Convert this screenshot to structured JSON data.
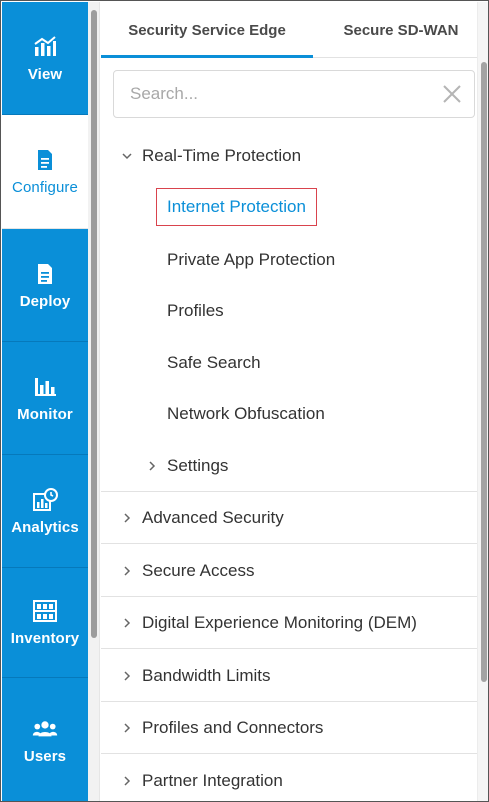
{
  "nav": {
    "items": [
      {
        "id": "view",
        "label": "View",
        "icon": "chart-bars-icon"
      },
      {
        "id": "configure",
        "label": "Configure",
        "icon": "document-icon",
        "active": true
      },
      {
        "id": "deploy",
        "label": "Deploy",
        "icon": "document-icon"
      },
      {
        "id": "monitor",
        "label": "Monitor",
        "icon": "bar-chart-icon"
      },
      {
        "id": "analytics",
        "label": "Analytics",
        "icon": "chart-clock-icon"
      },
      {
        "id": "inventory",
        "label": "Inventory",
        "icon": "inventory-icon"
      },
      {
        "id": "users",
        "label": "Users",
        "icon": "users-icon"
      }
    ]
  },
  "tabs": [
    {
      "label": "Security Service Edge",
      "active": true
    },
    {
      "label": "Secure SD-WAN",
      "active": false
    }
  ],
  "search": {
    "placeholder": "Search...",
    "value": ""
  },
  "tree": {
    "realtime": {
      "label": "Real-Time Protection",
      "expanded": true
    },
    "children": [
      {
        "label": "Internet Protection",
        "selected": true
      },
      {
        "label": "Private App Protection"
      },
      {
        "label": "Profiles"
      },
      {
        "label": "Safe Search"
      },
      {
        "label": "Network Obfuscation"
      },
      {
        "label": "Settings",
        "collapsed": true
      }
    ],
    "sections": [
      {
        "label": "Advanced Security"
      },
      {
        "label": "Secure Access"
      },
      {
        "label": "Digital Experience Monitoring (DEM)"
      },
      {
        "label": "Bandwidth Limits"
      },
      {
        "label": "Profiles and Connectors"
      },
      {
        "label": "Partner Integration"
      }
    ]
  },
  "colors": {
    "accent": "#0a8fd8",
    "selection_border": "#d9434d"
  }
}
